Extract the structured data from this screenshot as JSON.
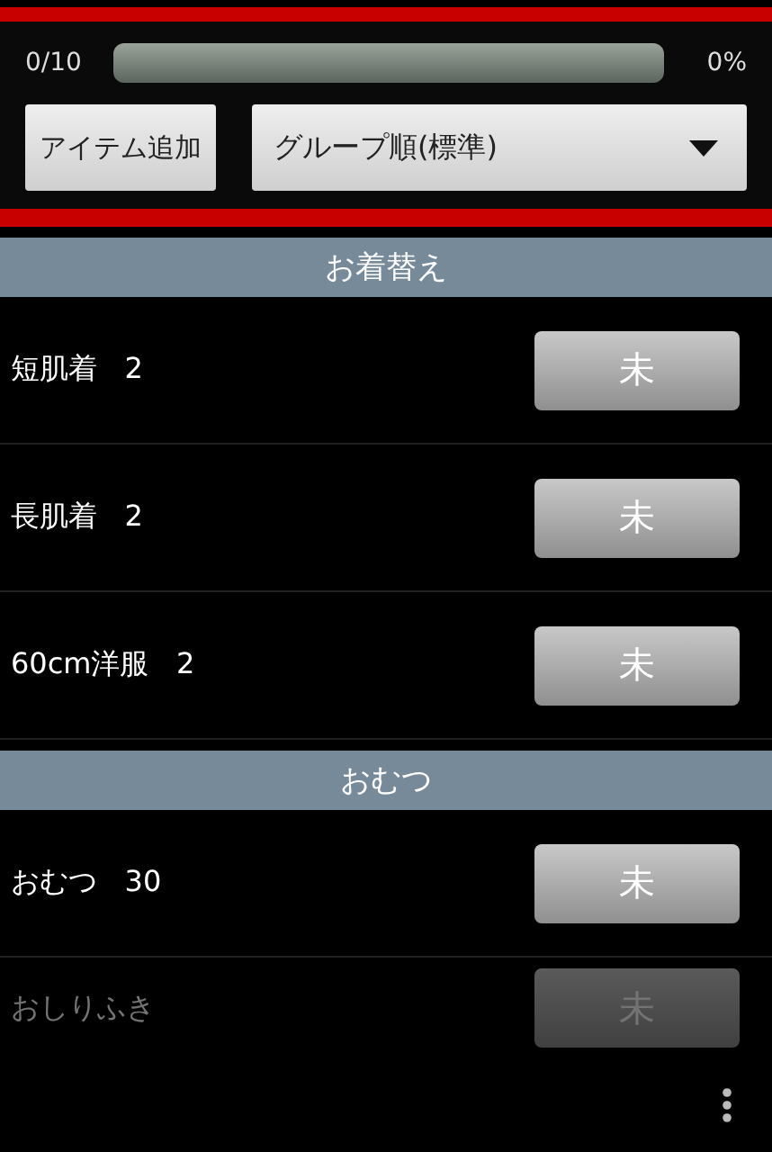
{
  "progress": {
    "counter": "0/10",
    "level": 0,
    "percent": "0%"
  },
  "add_button": "アイテム追加",
  "sort_dropdown": {
    "value": "グループ順(標準)",
    "expanded": false
  },
  "groups": [
    {
      "title": "お着替え",
      "items": [
        {
          "name": "短肌着",
          "count": "2",
          "status": "未",
          "done": false
        },
        {
          "name": "長肌着",
          "count": "2",
          "status": "未",
          "done": false
        },
        {
          "name": "60cm洋服",
          "count": "2",
          "status": "未",
          "done": false
        }
      ]
    },
    {
      "title": "おむつ",
      "items": [
        {
          "name": "おむつ",
          "count": "30",
          "status": "未",
          "done": false
        },
        {
          "name": "おしりふき",
          "status": "未",
          "done": false,
          "faded": true
        }
      ]
    }
  ]
}
